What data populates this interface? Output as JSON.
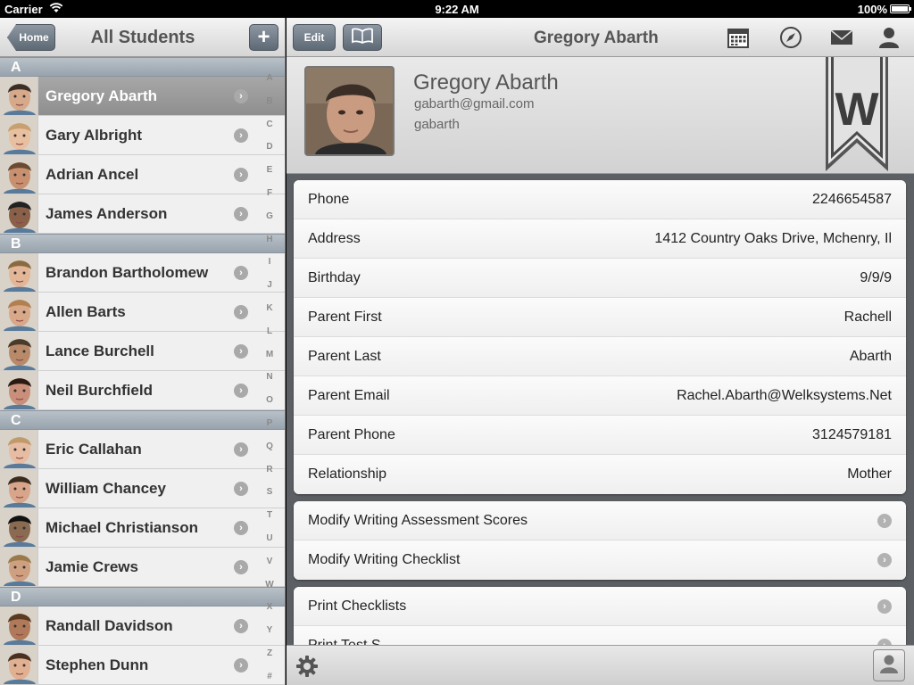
{
  "status_bar": {
    "carrier": "Carrier",
    "time": "9:22 AM",
    "battery": "100%"
  },
  "left_nav": {
    "home_label": "Home",
    "title": "All Students",
    "add_label": "+"
  },
  "sections": [
    {
      "letter": "A",
      "students": [
        {
          "name": "Gregory Abarth",
          "selected": true
        },
        {
          "name": "Gary Albright"
        },
        {
          "name": "Adrian Ancel"
        },
        {
          "name": "James Anderson"
        }
      ]
    },
    {
      "letter": "B",
      "students": [
        {
          "name": "Brandon Bartholomew"
        },
        {
          "name": "Allen Barts"
        },
        {
          "name": "Lance Burchell"
        },
        {
          "name": "Neil Burchfield"
        }
      ]
    },
    {
      "letter": "C",
      "students": [
        {
          "name": "Eric Callahan"
        },
        {
          "name": "William Chancey"
        },
        {
          "name": "Michael Christianson"
        },
        {
          "name": "Jamie Crews"
        }
      ]
    },
    {
      "letter": "D",
      "students": [
        {
          "name": "Randall Davidson"
        },
        {
          "name": "Stephen Dunn"
        }
      ]
    }
  ],
  "index_letters": [
    "A",
    "B",
    "C",
    "D",
    "E",
    "F",
    "G",
    "H",
    "I",
    "J",
    "K",
    "L",
    "M",
    "N",
    "O",
    "P",
    "Q",
    "R",
    "S",
    "T",
    "U",
    "V",
    "W",
    "X",
    "Y",
    "Z",
    "#"
  ],
  "right_nav": {
    "edit_label": "Edit",
    "title": "Gregory Abarth"
  },
  "profile": {
    "name": "Gregory Abarth",
    "email": "gabarth@gmail.com",
    "username": "gabarth",
    "ribbon_letter": "W"
  },
  "details": [
    {
      "label": "Phone",
      "value": "2246654587"
    },
    {
      "label": "Address",
      "value": "1412 Country Oaks Drive, Mchenry, Il"
    },
    {
      "label": "Birthday",
      "value": "9/9/9"
    },
    {
      "label": "Parent First",
      "value": "Rachell"
    },
    {
      "label": "Parent Last",
      "value": "Abarth"
    },
    {
      "label": "Parent Email",
      "value": "Rachel.Abarth@Welksystems.Net"
    },
    {
      "label": "Parent Phone",
      "value": "3124579181"
    },
    {
      "label": "Relationship",
      "value": "Mother"
    }
  ],
  "actions_1": [
    {
      "label": "Modify Writing Assessment Scores"
    },
    {
      "label": "Modify Writing Checklist"
    }
  ],
  "actions_2": [
    {
      "label": "Print Checklists"
    },
    {
      "label": "Print Test S..."
    }
  ],
  "colors": {
    "nav_button": "#6f7b87",
    "section_header": "#a8b1b9",
    "selected_row": "#9b9b9b",
    "background_dark": "#5c5f63"
  }
}
